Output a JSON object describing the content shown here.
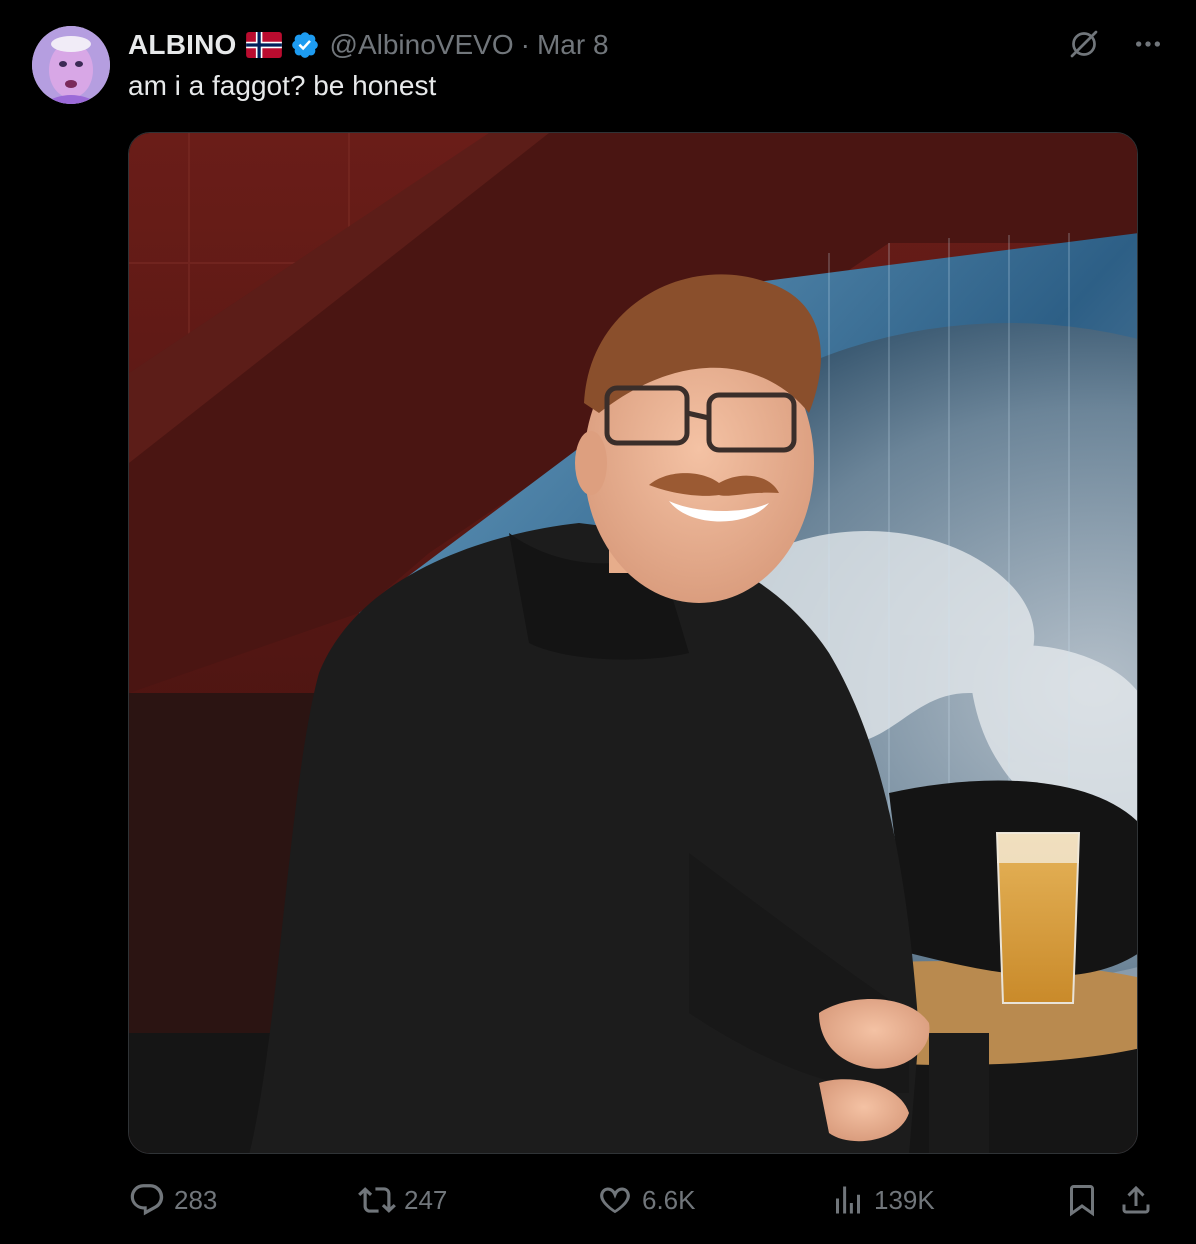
{
  "tweet": {
    "display_name": "ALBINO",
    "flag": "norway-flag",
    "verified": true,
    "handle": "@AlbinoVEVO",
    "separator": "·",
    "date": "Mar 8",
    "text": "am i a faggot? be honest"
  },
  "top_icons": [
    "grok-icon",
    "more-icon"
  ],
  "media": {
    "type": "photo",
    "description_icon": "photo"
  },
  "actions": {
    "replies": "283",
    "reposts": "247",
    "likes": "6.6K",
    "views": "139K"
  },
  "colors": {
    "background": "#000000",
    "text": "#e7e9ea",
    "muted": "#71767b",
    "verified": "#1d9bf0"
  }
}
